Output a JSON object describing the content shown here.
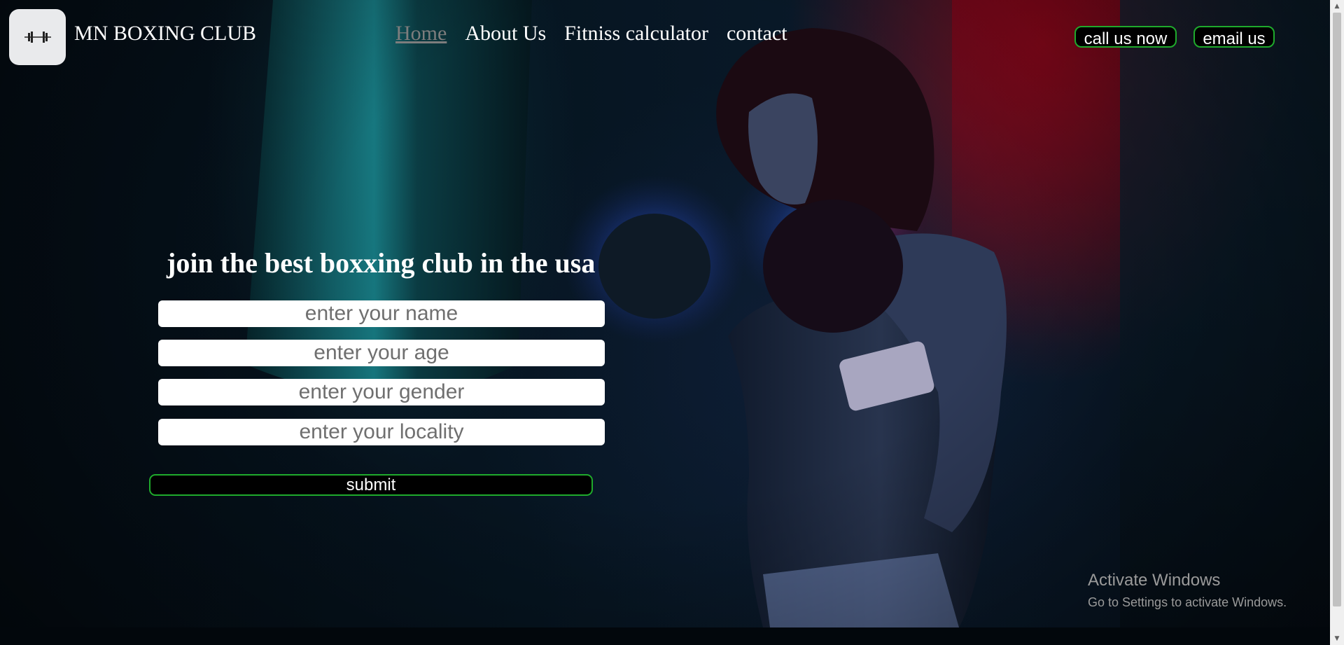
{
  "header": {
    "brand": "MN BOXING CLUB",
    "logo_icon": "dumbbell-icon",
    "nav": [
      "Home",
      "About Us",
      "Fitniss calculator",
      "contact"
    ],
    "active_nav": "Home",
    "call_button": "call us now",
    "email_button": "email us"
  },
  "form": {
    "headline": "join the best boxxing club in the usa",
    "fields": [
      {
        "placeholder": "enter your name"
      },
      {
        "placeholder": "enter your age"
      },
      {
        "placeholder": "enter your gender"
      },
      {
        "placeholder": "enter your locality"
      }
    ],
    "submit": "submit"
  },
  "watermark": {
    "title": "Activate Windows",
    "subtitle": "Go to Settings to activate Windows."
  },
  "colors": {
    "accent_border": "#1faa2c",
    "nav_active": "#7d7d7d"
  }
}
